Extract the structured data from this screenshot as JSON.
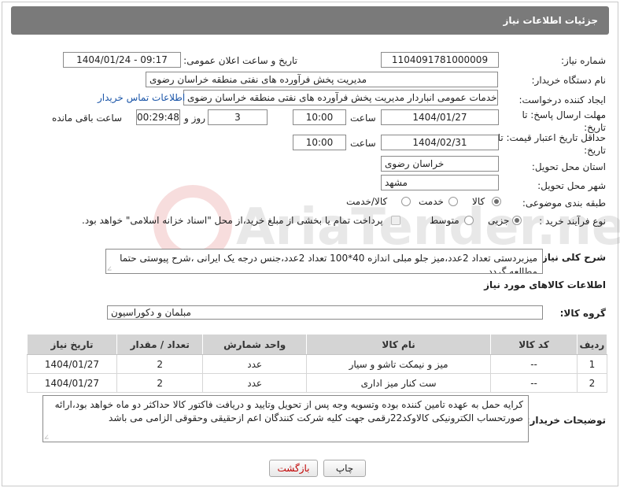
{
  "header": {
    "title": "جزئیات اطلاعات نیاز"
  },
  "fields": {
    "need_number_label": "شماره نیاز:",
    "need_number": "1104091781000009",
    "announce_label": "تاریخ و ساعت اعلان عمومی:",
    "announce_value": "1404/01/24 - 09:17",
    "buyer_label": "نام دستگاه خریدار:",
    "buyer_value": "مدیریت پخش فرآورده های نفتی منطقه خراسان رضوی",
    "creator_label": "ایجاد کننده درخواست:",
    "creator_value": "ابراهیم ذبیحی متصدی خدمات عمومی انباردار مدیریت پخش فرآورده های نفتی منطقه خراسان رضوی",
    "contact_link": "اطلاعات تماس خریدار",
    "deadline_label": "مهلت ارسال پاسخ: تا تاریخ:",
    "deadline_date": "1404/01/27",
    "time_word": "ساعت",
    "deadline_time": "10:00",
    "days_value": "3",
    "days_word": "روز و",
    "remaining_value": "00:29:48",
    "remaining_word": "ساعت باقی مانده",
    "validity_label": "حداقل تاریخ اعتبار قیمت: تا تاریخ:",
    "validity_date": "1404/02/31",
    "validity_time": "10:00",
    "province_label": "استان محل تحویل:",
    "province_value": "خراسان رضوی",
    "city_label": "شهر محل تحویل:",
    "city_value": "مشهد",
    "category_label": "طبقه بندی موضوعی:",
    "category_options": [
      "کالا",
      "خدمت",
      "کالا/خدمت"
    ],
    "process_label": "نوع فرآیند خرید :",
    "process_options": [
      "جزیی",
      "متوسط"
    ],
    "payment_note": "پرداخت تمام یا بخشی از مبلغ خرید،از محل \"اسناد خزانه اسلامی\" خواهد بود."
  },
  "description": {
    "label": "شرح کلی نیاز:",
    "text": "میزبردستی تعداد 2عدد،میز جلو مبلی اندازه 40*100 تعداد 2عدد،جنس درجه یک ایرانی ،شرح پیوستی حتما مطالعه گردد."
  },
  "goods_section": {
    "title": "اطلاعات کالاهای مورد نیاز",
    "group_label": "گروه کالا:",
    "group_value": "مبلمان و دکوراسیون"
  },
  "table": {
    "headers": [
      "ردیف",
      "کد کالا",
      "نام کالا",
      "واحد شمارش",
      "تعداد / مقدار",
      "تاریخ نیاز"
    ],
    "rows": [
      [
        "1",
        "--",
        "میز و نیمکت تاشو و سیار",
        "عدد",
        "2",
        "1404/01/27"
      ],
      [
        "2",
        "--",
        "ست کنار میز اداری",
        "عدد",
        "2",
        "1404/01/27"
      ]
    ]
  },
  "buyer_notes": {
    "label": "توضیحات خریدار:",
    "text": "کرایه حمل به عهده تامین کننده بوده وتسویه وجه پس از تحویل وتایید و دریافت فاکتور کالا حداکثر دو ماه خواهد بود،ارائه صورتحساب الکترونیکی کالاوکد22رقمی جهت کلیه شرکت کنندگان اعم ازحقیقی وحقوقی الزامی می باشد"
  },
  "buttons": {
    "print": "چاپ",
    "back": "بازگشت"
  },
  "watermark": {
    "text": "AriaTender.net"
  },
  "colors": {
    "header_bg": "#7a7a7a",
    "link": "#1a55a8",
    "table_header_bg": "#d4d4d4"
  }
}
